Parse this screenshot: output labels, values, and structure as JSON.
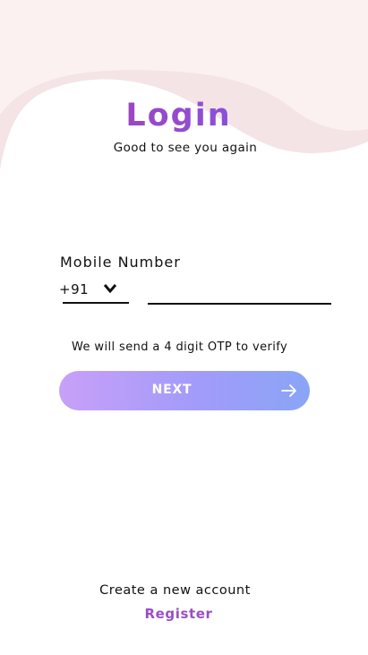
{
  "colors": {
    "background": "#ffffff",
    "wave_light": "#f5e6e7",
    "wave_lighter": "#fbf0f0",
    "title_gradient": [
      "#b13aa8",
      "#6f55e0"
    ],
    "button_gradient": [
      "#c8a0f8",
      "#8aa5f5"
    ],
    "register_link": "#9a4fc3"
  },
  "header": {
    "title": "Login",
    "subtitle": "Good to see you again"
  },
  "form": {
    "mobile_label": "Mobile Number",
    "country_code": "+91",
    "country_icon": "chevron-down-icon",
    "phone_value": "",
    "phone_placeholder": "",
    "otp_note": "We will send a 4 digit OTP to verify",
    "next_label": "NEXT",
    "next_icon": "arrow-right-icon"
  },
  "footer": {
    "create_text": "Create a new account",
    "register_label": "Register"
  }
}
